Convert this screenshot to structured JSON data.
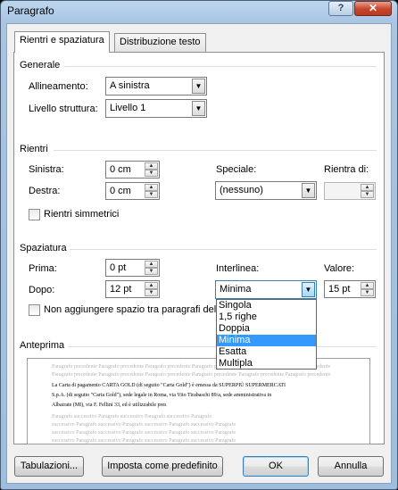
{
  "window": {
    "title": "Paragrafo",
    "help": "?",
    "close": "✕"
  },
  "tabs": [
    "Rientri e spaziatura",
    "Distribuzione testo"
  ],
  "generale": {
    "section": "Generale",
    "allineamento_label": "Allineamento:",
    "allineamento_value": "A sinistra",
    "livello_label": "Livello struttura:",
    "livello_value": "Livello 1"
  },
  "rientri": {
    "section": "Rientri",
    "sinistra_label": "Sinistra:",
    "sinistra_value": "0 cm",
    "destra_label": "Destra:",
    "destra_value": "0 cm",
    "speciale_label": "Speciale:",
    "speciale_value": "(nessuno)",
    "rientra_label": "Rientra di:",
    "rientra_value": "",
    "simmetrici_label": "Rientri simmetrici"
  },
  "spaziatura": {
    "section": "Spaziatura",
    "prima_label": "Prima:",
    "prima_value": "0 pt",
    "dopo_label": "Dopo:",
    "dopo_value": "12 pt",
    "interlinea_label": "Interlinea:",
    "interlinea_value": "Minima",
    "valore_label": "Valore:",
    "valore_value": "15 pt",
    "non_aggiungere_label": "Non aggiungere spazio tra paragrafi dell",
    "options": [
      "Singola",
      "1,5 righe",
      "Doppia",
      "Minima",
      "Esatta",
      "Multipla"
    ],
    "selected_option": "Minima"
  },
  "anteprima": {
    "section": "Anteprima",
    "prev_lines": [
      "Paragrafo precedente Paragrafo precedente Paragrafo precedente Paragrafo precedente Paragrafo precedente Paragrafo precedente",
      "Paragrafo precedente Paragrafo precedente Paragrafo precedente Paragrafo precedente Paragrafo precedente Paragrafo precedente"
    ],
    "main_lines": [
      "La Carta di pagamento CARTA GOLD (di seguito \"Carta Gold\") è emessa da SUPERPIÙ SUPERMERCATI",
      "S.p.A. (di seguito \"Carta Gold\"), sede legale in Roma, via Vito Tirabaschi 89/a, sede amministrativa in",
      "Albairate (MI), via F. Fellini 33, ed è utilizzabile pres"
    ],
    "next_lines": [
      "Paragrafo successivo Paragrafo successivo Paragrafo successivo Paragrafo",
      "successivo Paragrafo successivo Paragrafo successivo Paragrafo successivo Paragrafo",
      "successivo Paragrafo successivo Paragrafo successivo Paragrafo successivo Paragrafo",
      "successivo Paragrafo successivo Paragrafo successivo Paragrafo successivo Paragrafo"
    ]
  },
  "buttons": {
    "tabulazioni": "Tabulazioni...",
    "predefinito": "Imposta come predefinito",
    "ok": "OK",
    "annulla": "Annulla"
  }
}
